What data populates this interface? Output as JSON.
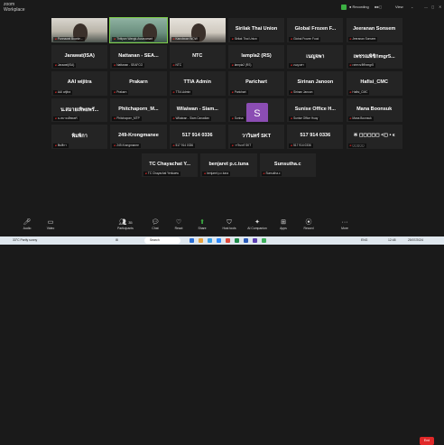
{
  "app": {
    "logo_line1": "zoom",
    "logo_line2": "Workplace"
  },
  "top_right": {
    "recording": "● Recording",
    "view": "View"
  },
  "tiles": [
    {
      "name": "",
      "label": "Pannawat Boonle...",
      "video": "v1"
    },
    {
      "name": "",
      "label": "Thitipan Wangk-Assavamart",
      "video": "v2"
    },
    {
      "name": "",
      "label": "Kanokwan WOW",
      "video": "v3"
    },
    {
      "name": "Sirilak Thai Union",
      "label": "Sirilak Thai Union"
    },
    {
      "name": "Global Frozen F...",
      "label": "Global Frozen Food"
    },
    {
      "name": "Jeeranan Sonsem",
      "label": "Jeeranan Sonsem"
    },
    {
      "name": "Jarawat(ISA)",
      "label": "Jarawat(ISA)"
    },
    {
      "name": "Nattanan - SEA...",
      "label": "Nattanan - SEAFCO"
    },
    {
      "name": "NTC",
      "label": "NTC"
    },
    {
      "name": "lampla2 (RS)",
      "label": "lampla2 (RS)"
    },
    {
      "name": "เนญจพา",
      "label": "เนญจพา"
    },
    {
      "name": "เพชรณพิชิกmgr5...",
      "label": "เพชรณพิชิกmgr5"
    },
    {
      "name": "AAI wijitra",
      "label": "AAI wijitra"
    },
    {
      "name": "Prakarn",
      "label": "Prakarn"
    },
    {
      "name": "TTIA Admin",
      "label": "TTIA Admin"
    },
    {
      "name": "Parichart",
      "label": "Parichart"
    },
    {
      "name": "Sirinan Janoon",
      "label": "Sirinan Janoon"
    },
    {
      "name": "Hafisi_CMC",
      "label": "Hafisi_CMC"
    },
    {
      "name": "น.สมายเทิพยพรั...",
      "label": "น.สมายเทิพยพรั"
    },
    {
      "name": "Phitchaporn_M...",
      "label": "Phitchaporn_MTP"
    },
    {
      "name": "Wilaiwan - Siam...",
      "label": "Wilaiwan - Siam Canadian"
    },
    {
      "name": "",
      "label": "Sunisa",
      "avatar": "S"
    },
    {
      "name": "Sunise Office H...",
      "label": "Sunise Office Huay"
    },
    {
      "name": "Mana Boonsuk",
      "label": "Mana Boonsuk"
    },
    {
      "name": "พิมพิกา",
      "label": "พิมพิกา"
    },
    {
      "name": "249-Krongmanee",
      "label": "249-Krongmanee"
    },
    {
      "name": "517 914 0336",
      "label": "517 914 0336"
    },
    {
      "name": "วาวินทร์ SKT",
      "label": "วาวินทร์ SKT"
    },
    {
      "name": "517 914 0336",
      "label": "517 914 0336"
    },
    {
      "name": "※ ◻◻◻◻◻ <◻ • ϵ",
      "label": "◻◻◻◻◻"
    },
    {
      "name": "TC Chayachat Y...",
      "label": "TC Chayachat Yenkaew"
    },
    {
      "name": "benjaret p.c.tuna",
      "label": "benjaret p.c.tuna"
    },
    {
      "name": "Sunsutha.c",
      "label": "Sunsutha.c"
    }
  ],
  "toolbar": {
    "audio": "Audio",
    "video": "Video",
    "participants": "Participants",
    "participants_count": "35",
    "chat": "Chat",
    "react": "React",
    "share": "Share",
    "host_tools": "Host tools",
    "ai_companion": "AI Companion",
    "apps": "Apps",
    "record": "Record",
    "more": "More",
    "end": "End"
  },
  "taskbar": {
    "weather": "33°C Partly sunny",
    "search": "Search",
    "time": "12:48",
    "date": "25/07/2024",
    "lang": "ENG"
  },
  "colors": {
    "background": "#1a1a1a",
    "tile": "#242424",
    "muted_icon": "#e02828",
    "end_button": "#e02828",
    "avatar": "#8b4db3",
    "active_speaker": "#7ecf4a"
  }
}
